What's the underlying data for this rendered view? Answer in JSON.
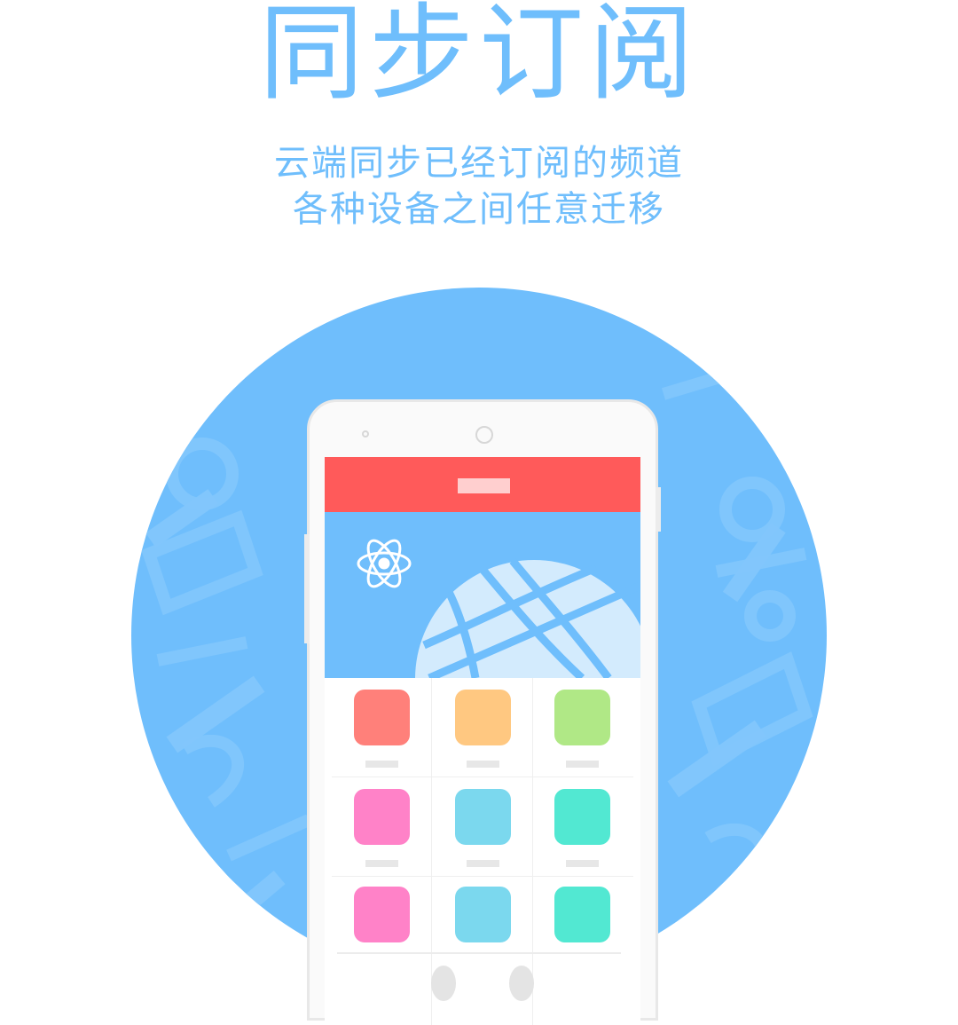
{
  "header": {
    "title": "同步订阅",
    "subtitle_line1": "云端同步已经订阅的频道",
    "subtitle_line2": "各种设备之间任意迁移"
  },
  "colors": {
    "accent": "#6fbefc",
    "appbar": "#ff5a5a",
    "appbar_pill": "#ffcfcf",
    "globe": "#d3ebfd",
    "tiles": [
      "#ff807a",
      "#ffc881",
      "#b0e886",
      "#ff82c8",
      "#7bd8ee",
      "#52e8d2",
      "#ff82c8",
      "#7bd8ee",
      "#52e8d2"
    ]
  },
  "icons": {
    "banner_left": "atom-icon",
    "banner_main": "globe-icon"
  },
  "background_logos": [
    "eica",
    "ifanr",
    "flickr",
    "知乎",
    "36Kr",
    "engadget",
    "知乎日报",
    "财经网",
    "煎蛋",
    "apple",
    "500px",
    "mina",
    "豆瓣"
  ]
}
